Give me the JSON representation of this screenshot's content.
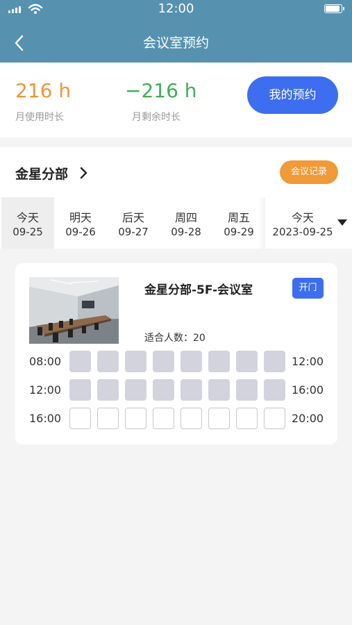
{
  "status_bar": {
    "time": "12:00"
  },
  "header": {
    "title": "会议室预约"
  },
  "stats": {
    "used": {
      "value": "216 h",
      "label": "月使用时长",
      "color": "#f0943a"
    },
    "remaining": {
      "value": "−216 h",
      "label": "月剩余时长",
      "color": "#3fae56"
    },
    "my_booking_label": "我的预约"
  },
  "branch": {
    "name": "金星分部",
    "records_label": "会议记录"
  },
  "dates": [
    {
      "day": "今天",
      "date": "09-25",
      "selected": true
    },
    {
      "day": "明天",
      "date": "09-26",
      "selected": false
    },
    {
      "day": "后天",
      "date": "09-27",
      "selected": false
    },
    {
      "day": "周四",
      "date": "09-28",
      "selected": false
    },
    {
      "day": "周五",
      "date": "09-29",
      "selected": false
    }
  ],
  "date_picker": {
    "day": "今天",
    "date": "2023-09-25"
  },
  "room": {
    "name": "金星分部-5F-会议室",
    "open_label": "开门",
    "capacity_text": "适合人数：20",
    "slot_rows": [
      {
        "start": "08:00",
        "end": "12:00",
        "slots": [
          "booked",
          "booked",
          "booked",
          "booked",
          "booked",
          "booked",
          "booked",
          "booked"
        ]
      },
      {
        "start": "12:00",
        "end": "16:00",
        "slots": [
          "booked",
          "booked",
          "booked",
          "booked",
          "booked",
          "booked",
          "booked",
          "booked"
        ]
      },
      {
        "start": "16:00",
        "end": "20:00",
        "slots": [
          "free",
          "free",
          "free",
          "free",
          "free",
          "free",
          "free",
          "free"
        ]
      }
    ]
  }
}
